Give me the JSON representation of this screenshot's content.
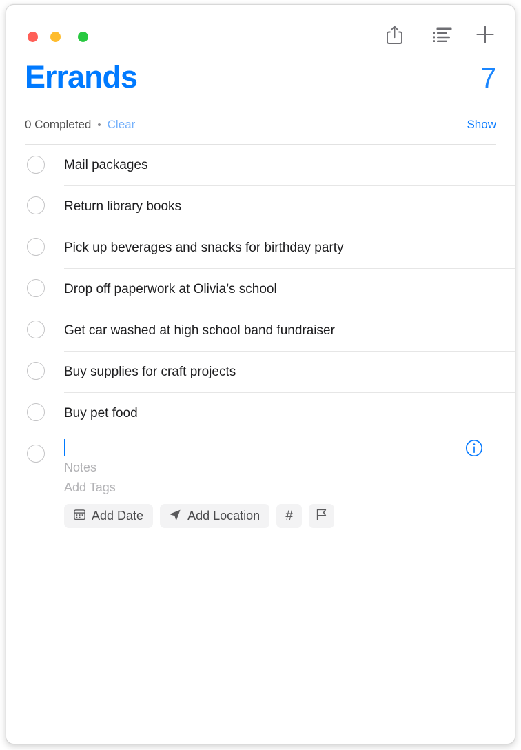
{
  "window": {
    "traffic_lights": [
      {
        "name": "close",
        "color": "#ff5f57"
      },
      {
        "name": "minimize",
        "color": "#febc2e"
      },
      {
        "name": "zoom",
        "color": "#28c840"
      }
    ]
  },
  "toolbar": {
    "share_icon": "share-icon",
    "list_view_icon": "list-view-icon",
    "add_icon": "plus-icon"
  },
  "header": {
    "title": "Errands",
    "count": "7",
    "completed_text": "0 Completed",
    "separator_dot": "•",
    "clear_label": "Clear",
    "show_label": "Show",
    "title_color": "#007aff",
    "count_color": "#1a86ff",
    "clear_color": "#74b0fb",
    "show_color": "#0a7cff"
  },
  "reminders": [
    {
      "text": "Mail packages",
      "completed": false
    },
    {
      "text": "Return library books",
      "completed": false
    },
    {
      "text": "Pick up beverages and snacks for birthday party",
      "completed": false
    },
    {
      "text": "Drop off paperwork at Olivia’s school",
      "completed": false
    },
    {
      "text": "Get car washed at high school band fundraiser",
      "completed": false
    },
    {
      "text": "Buy supplies for craft projects",
      "completed": false
    },
    {
      "text": "Buy pet food",
      "completed": false
    }
  ],
  "new_reminder": {
    "title_value": "",
    "notes_placeholder": "Notes",
    "tags_placeholder": "Add Tags",
    "info_icon": "info-circle-icon",
    "cursor_color": "#007aff",
    "actions": [
      {
        "name": "add-date",
        "label": "Add Date",
        "icon": "calendar-icon"
      },
      {
        "name": "add-location",
        "label": "Add Location",
        "icon": "location-arrow-icon"
      },
      {
        "name": "add-tag",
        "label": "#",
        "icon": "hash-icon"
      },
      {
        "name": "add-flag",
        "label": "",
        "icon": "flag-icon"
      }
    ]
  }
}
